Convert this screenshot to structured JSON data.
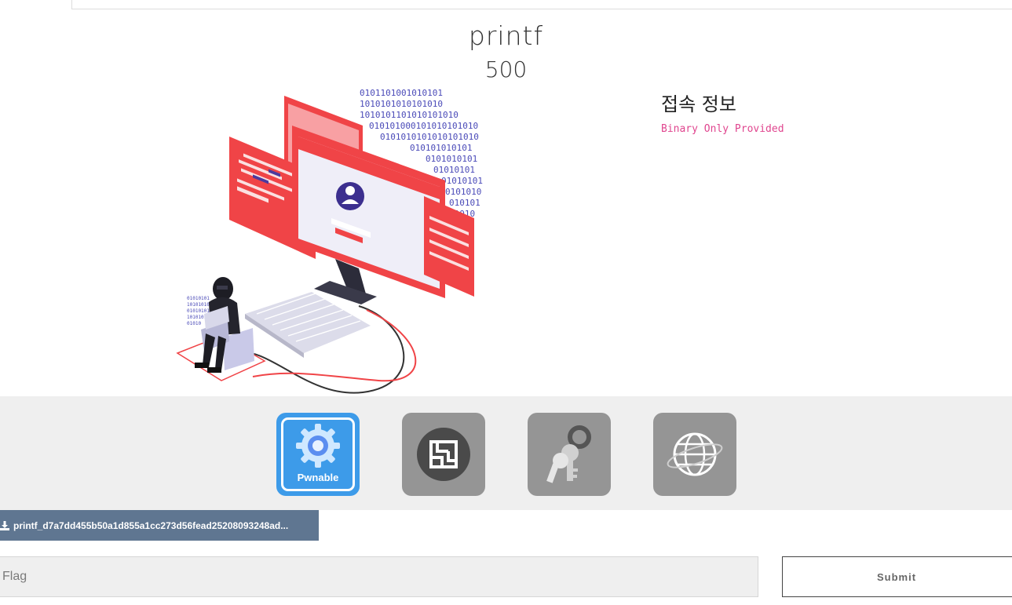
{
  "challenge": {
    "name": "printf",
    "points": "500"
  },
  "connection": {
    "heading": "접속 정보",
    "value": "Binary Only Provided"
  },
  "categories": [
    {
      "icon": "gear-icon",
      "label": "Pwnable",
      "active": true
    },
    {
      "icon": "maze-icon",
      "label": "",
      "active": false
    },
    {
      "icon": "key-icon",
      "label": "",
      "active": false
    },
    {
      "icon": "globe-icon",
      "label": "",
      "active": false
    }
  ],
  "download": {
    "icon": "download-icon",
    "filename": "printf_d7a7dd455b50a1d855a1cc273d56fead25208093248ad..."
  },
  "flag_form": {
    "placeholder": "Flag",
    "value": "",
    "submit_label": "Submit"
  },
  "colors": {
    "active_category": "#3d9be9",
    "inactive_category": "#959595",
    "download_bg": "#5f7691",
    "connection_value": "#e0468f",
    "hero_red": "#f04447"
  }
}
